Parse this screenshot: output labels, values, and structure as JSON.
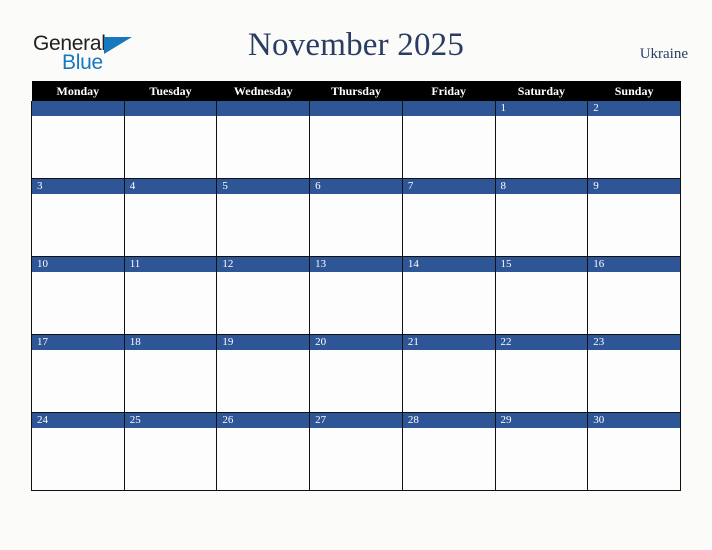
{
  "branding": {
    "logo_primary": "General",
    "logo_secondary": "Blue",
    "logo_triangle_icon": "triangle-icon",
    "accent_color": "#1878be"
  },
  "header": {
    "title": "November 2025",
    "region": "Ukraine",
    "title_color": "#2b3c63"
  },
  "calendar": {
    "weekday_headers": [
      "Monday",
      "Tuesday",
      "Wednesday",
      "Thursday",
      "Friday",
      "Saturday",
      "Sunday"
    ],
    "header_background": "#000000",
    "date_band_color": "#2e5596",
    "cell_background": "#fdfdfd",
    "weeks": [
      [
        "",
        "",
        "",
        "",
        "",
        "1",
        "2"
      ],
      [
        "3",
        "4",
        "5",
        "6",
        "7",
        "8",
        "9"
      ],
      [
        "10",
        "11",
        "12",
        "13",
        "14",
        "15",
        "16"
      ],
      [
        "17",
        "18",
        "19",
        "20",
        "21",
        "22",
        "23"
      ],
      [
        "24",
        "25",
        "26",
        "27",
        "28",
        "29",
        "30"
      ]
    ]
  }
}
